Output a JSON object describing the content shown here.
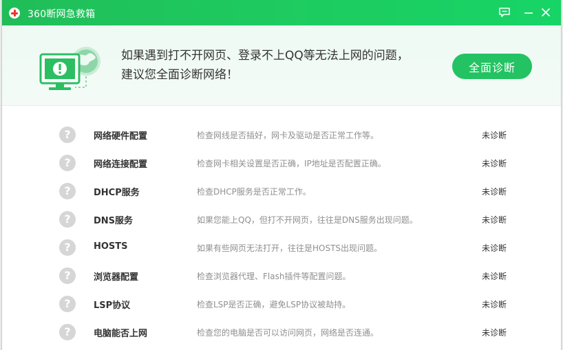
{
  "window": {
    "title": "360断网急救箱",
    "icons": [
      "app-cross-icon",
      "feedback-icon",
      "minimize-icon",
      "close-icon"
    ]
  },
  "banner": {
    "line1": "如果遇到打不开网页、登录不上QQ等无法上网的问题，",
    "line2": "建议您全面诊断网络！",
    "button_label": "全面诊断",
    "illustration": "computer-globe-icon"
  },
  "colors": {
    "accent": "#23c262",
    "titlebar": "#1ecb60",
    "status_unknown_icon": "#d6d6d6"
  },
  "items": [
    {
      "name": "网络硬件配置",
      "desc": "检查网线是否插好，网卡及驱动是否正常工作等。",
      "status": "未诊断",
      "icon": "question-icon"
    },
    {
      "name": "网络连接配置",
      "desc": "检查网卡相关设置是否正确，IP地址是否配置正确。",
      "status": "未诊断",
      "icon": "question-icon"
    },
    {
      "name": "DHCP服务",
      "desc": "检查DHCP服务是否正常工作。",
      "status": "未诊断",
      "icon": "question-icon"
    },
    {
      "name": "DNS服务",
      "desc": "如果您能上QQ，但打不开网页，往往是DNS服务出现问题。",
      "status": "未诊断",
      "icon": "question-icon"
    },
    {
      "name": "HOSTS",
      "desc": "如果有些网页无法打开，往往是HOSTS出现问题。",
      "status": "未诊断",
      "icon": "question-icon"
    },
    {
      "name": "浏览器配置",
      "desc": "检查浏览器代理、Flash插件等配置问题。",
      "status": "未诊断",
      "icon": "question-icon"
    },
    {
      "name": "LSP协议",
      "desc": "检查LSP是否正确，避免LSP协议被劫持。",
      "status": "未诊断",
      "icon": "question-icon"
    },
    {
      "name": "电脑能否上网",
      "desc": "检查您的电脑是否可以访问网页，网络是否连通。",
      "status": "未诊断",
      "icon": "question-icon"
    }
  ]
}
